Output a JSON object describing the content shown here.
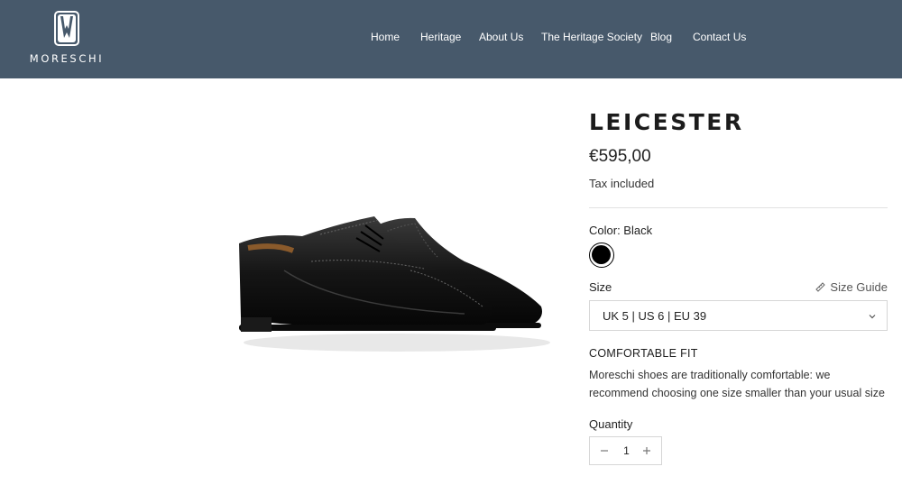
{
  "brand": {
    "name": "MORESCHI"
  },
  "nav": {
    "items": [
      "Home",
      "Heritage",
      "About Us",
      "The Heritage Society",
      "Blog",
      "Contact Us"
    ]
  },
  "product": {
    "title": "LEICESTER",
    "price": "€595,00",
    "tax_note": "Tax included",
    "color_label": "Color: Black",
    "color_swatch": "#000000",
    "size_label": "Size",
    "size_guide_label": "Size Guide",
    "size_selected": "UK 5 | US 6 | EU 39",
    "fit_title": "COMFORTABLE FIT",
    "fit_text": "Moreschi shoes are traditionally comfortable: we recommend choosing one size smaller than your usual size",
    "quantity_label": "Quantity",
    "quantity_value": "1"
  },
  "colors": {
    "header_bg": "#47596b"
  },
  "icons": {
    "size_guide": "ruler-icon",
    "select": "chevron-down-icon",
    "decrease": "minus-icon",
    "increase": "plus-icon"
  }
}
